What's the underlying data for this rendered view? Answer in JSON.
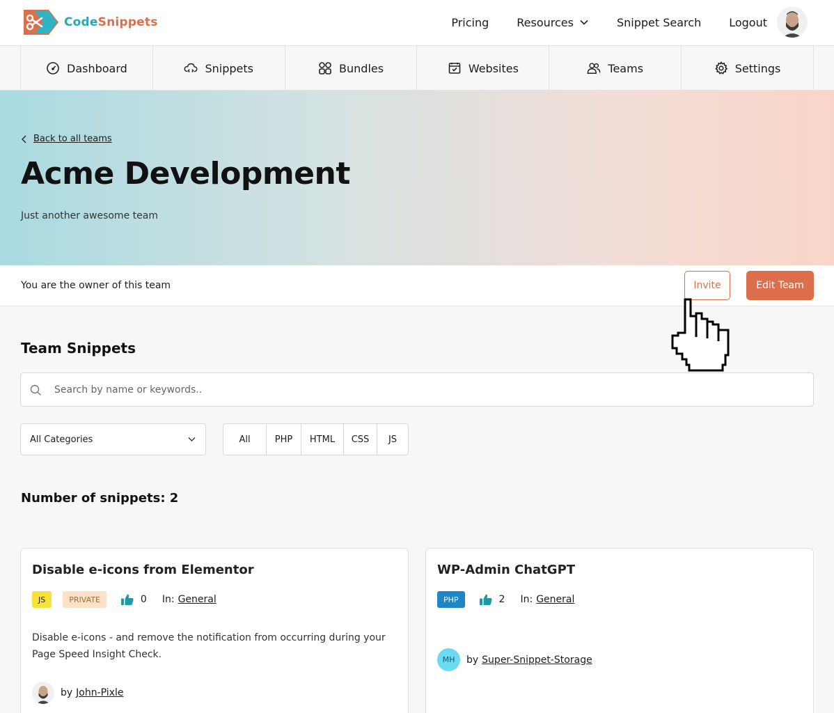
{
  "brand": {
    "name_part1": "Code",
    "name_part2": "Snippets"
  },
  "topnav": {
    "items": [
      {
        "label": "Pricing"
      },
      {
        "label": "Resources"
      },
      {
        "label": "Snippet Search"
      },
      {
        "label": "Logout"
      }
    ]
  },
  "tabs": [
    {
      "label": "Dashboard",
      "icon": "gauge-icon"
    },
    {
      "label": "Snippets",
      "icon": "cloud-code-icon"
    },
    {
      "label": "Bundles",
      "icon": "grid-icon"
    },
    {
      "label": "Websites",
      "icon": "browser-icon"
    },
    {
      "label": "Teams",
      "icon": "users-icon"
    },
    {
      "label": "Settings",
      "icon": "gear-icon"
    }
  ],
  "hero": {
    "back_label": "Back to all teams",
    "title": "Acme Development",
    "description": "Just another awesome team"
  },
  "owner_bar": {
    "text": "You are the owner of this team",
    "invite_label": "Invite",
    "edit_label": "Edit Team"
  },
  "snippets": {
    "section_title": "Team Snippets",
    "search_placeholder": "Search by name or keywords..",
    "category_selected": "All Categories",
    "languages": [
      "All",
      "PHP",
      "HTML",
      "CSS",
      "JS"
    ],
    "count_text": "Number of snippets: 2",
    "cards": [
      {
        "title": "Disable e-icons from Elementor",
        "lang_badge": "JS",
        "private_badge": "PRIVATE",
        "likes": "0",
        "in_label": "In:",
        "category": "General",
        "description": "Disable e-icons - and remove the notification from occurring during your Page Speed Insight Check.",
        "by_label": "by",
        "author": "John-Pixle"
      },
      {
        "title": "WP-Admin ChatGPT",
        "lang_badge": "PHP",
        "likes": "2",
        "in_label": "In:",
        "category": "General",
        "by_label": "by",
        "author_initials": "MH",
        "author": "Super-Snippet-Storage"
      }
    ]
  },
  "colors": {
    "accent": "#dd6e4b",
    "brand_teal": "#2aa6b8",
    "like_teal": "#1b9aa8",
    "js_badge": "#f7e23a",
    "php_badge": "#1e86c4"
  }
}
